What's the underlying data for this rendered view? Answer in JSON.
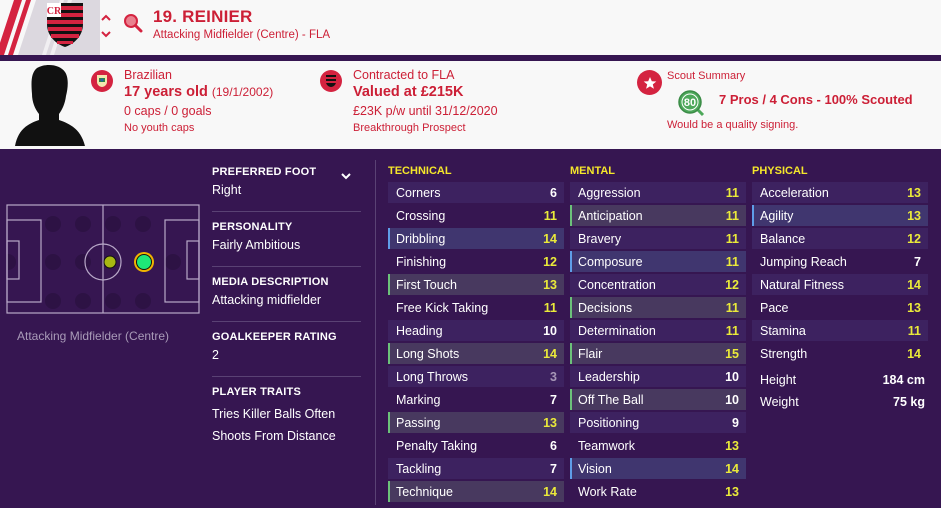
{
  "header": {
    "player_name": "19. REINIER",
    "subtitle": "Attacking Midfielder (Centre) - FLA",
    "icons": {
      "crest": "club-crest-flamengo",
      "prev": "chevron-up-icon",
      "next": "chevron-down-icon",
      "search": "search-icon"
    }
  },
  "info": {
    "nationality": {
      "icon": "brazil-flag-badge",
      "line1": "Brazilian",
      "age": "17 years old",
      "dob": "(19/1/2002)",
      "caps": "0 caps / 0 goals",
      "youth": "No youth caps"
    },
    "contract": {
      "icon": "club-badge-icon",
      "line1": "Contracted to FLA",
      "value": "Valued at £215K",
      "wage": "£23K p/w until 31/12/2020",
      "status": "Breakthrough Prospect"
    },
    "scout": {
      "icon": "star-icon",
      "title": "Scout Summary",
      "score": "80",
      "summary": "7 Pros / 4 Cons - 100% Scouted",
      "note": "Would be a quality signing."
    }
  },
  "position": {
    "label": "Attacking Midfielder (Centre)",
    "primary_color": "#1ee878",
    "secondary_color": "#a8b812"
  },
  "meta": {
    "preferred_foot": {
      "label": "PREFERRED FOOT",
      "value": "Right"
    },
    "personality": {
      "label": "PERSONALITY",
      "value": "Fairly Ambitious"
    },
    "media": {
      "label": "MEDIA DESCRIPTION",
      "value": "Attacking midfielder"
    },
    "gk_rating": {
      "label": "GOALKEEPER RATING",
      "value": "2"
    },
    "traits": {
      "label": "PLAYER TRAITS",
      "items": [
        "Tries Killer Balls Often",
        "Shoots From Distance"
      ]
    }
  },
  "attributes": {
    "technical": {
      "title": "TECHNICAL",
      "rows": [
        {
          "name": "Corners",
          "value": "6",
          "hl": ""
        },
        {
          "name": "Crossing",
          "value": "11",
          "hl": ""
        },
        {
          "name": "Dribbling",
          "value": "14",
          "hl": "blue"
        },
        {
          "name": "Finishing",
          "value": "12",
          "hl": ""
        },
        {
          "name": "First Touch",
          "value": "13",
          "hl": "green"
        },
        {
          "name": "Free Kick Taking",
          "value": "11",
          "hl": ""
        },
        {
          "name": "Heading",
          "value": "10",
          "hl": ""
        },
        {
          "name": "Long Shots",
          "value": "14",
          "hl": "green"
        },
        {
          "name": "Long Throws",
          "value": "3",
          "hl": ""
        },
        {
          "name": "Marking",
          "value": "7",
          "hl": ""
        },
        {
          "name": "Passing",
          "value": "13",
          "hl": "green"
        },
        {
          "name": "Penalty Taking",
          "value": "6",
          "hl": ""
        },
        {
          "name": "Tackling",
          "value": "7",
          "hl": ""
        },
        {
          "name": "Technique",
          "value": "14",
          "hl": "green"
        }
      ]
    },
    "mental": {
      "title": "MENTAL",
      "rows": [
        {
          "name": "Aggression",
          "value": "11",
          "hl": ""
        },
        {
          "name": "Anticipation",
          "value": "11",
          "hl": "green"
        },
        {
          "name": "Bravery",
          "value": "11",
          "hl": ""
        },
        {
          "name": "Composure",
          "value": "11",
          "hl": "blue"
        },
        {
          "name": "Concentration",
          "value": "12",
          "hl": ""
        },
        {
          "name": "Decisions",
          "value": "11",
          "hl": "green"
        },
        {
          "name": "Determination",
          "value": "11",
          "hl": ""
        },
        {
          "name": "Flair",
          "value": "15",
          "hl": "green"
        },
        {
          "name": "Leadership",
          "value": "10",
          "hl": ""
        },
        {
          "name": "Off The Ball",
          "value": "10",
          "hl": "green"
        },
        {
          "name": "Positioning",
          "value": "9",
          "hl": ""
        },
        {
          "name": "Teamwork",
          "value": "13",
          "hl": ""
        },
        {
          "name": "Vision",
          "value": "14",
          "hl": "blue"
        },
        {
          "name": "Work Rate",
          "value": "13",
          "hl": ""
        }
      ]
    },
    "physical": {
      "title": "PHYSICAL",
      "rows": [
        {
          "name": "Acceleration",
          "value": "13",
          "hl": ""
        },
        {
          "name": "Agility",
          "value": "13",
          "hl": "blue"
        },
        {
          "name": "Balance",
          "value": "12",
          "hl": ""
        },
        {
          "name": "Jumping Reach",
          "value": "7",
          "hl": ""
        },
        {
          "name": "Natural Fitness",
          "value": "14",
          "hl": ""
        },
        {
          "name": "Pace",
          "value": "13",
          "hl": ""
        },
        {
          "name": "Stamina",
          "value": "11",
          "hl": ""
        },
        {
          "name": "Strength",
          "value": "14",
          "hl": ""
        }
      ],
      "height": {
        "label": "Height",
        "value": "184 cm"
      },
      "weight": {
        "label": "Weight",
        "value": "75 kg"
      }
    }
  }
}
